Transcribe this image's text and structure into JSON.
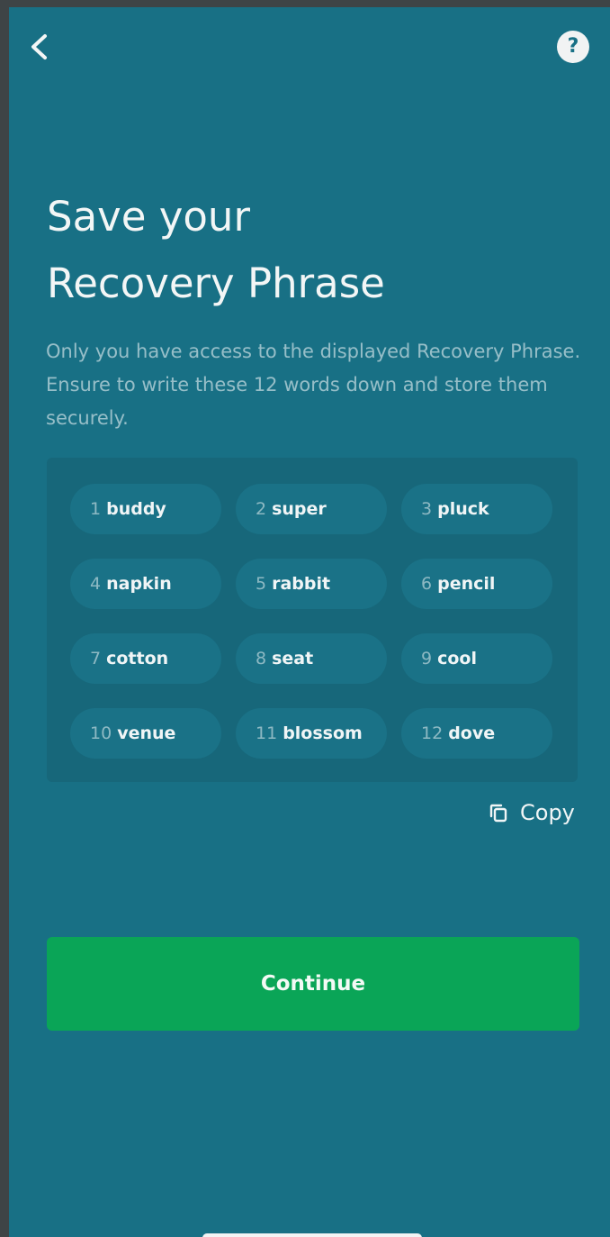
{
  "header": {
    "back_icon": "chevron-left-icon",
    "help_label": "?"
  },
  "title": {
    "line1": "Save your",
    "line2": "Recovery Phrase"
  },
  "subtitle": "Only you have access to the displayed Recovery Phrase. Ensure to write these 12 words down and store them securely.",
  "words": [
    {
      "num": "1",
      "word": "buddy"
    },
    {
      "num": "2",
      "word": "super"
    },
    {
      "num": "3",
      "word": "pluck"
    },
    {
      "num": "4",
      "word": "napkin"
    },
    {
      "num": "5",
      "word": "rabbit"
    },
    {
      "num": "6",
      "word": "pencil"
    },
    {
      "num": "7",
      "word": "cotton"
    },
    {
      "num": "8",
      "word": "seat"
    },
    {
      "num": "9",
      "word": "cool"
    },
    {
      "num": "10",
      "word": "venue"
    },
    {
      "num": "11",
      "word": "blossom"
    },
    {
      "num": "12",
      "word": "dove"
    }
  ],
  "copy": {
    "label": "Copy",
    "icon": "copy-icon"
  },
  "continue_label": "Continue",
  "colors": {
    "background": "#187085",
    "phrase_box": "#17677a",
    "chip": "#1a7287",
    "primary_button": "#0aa557"
  }
}
